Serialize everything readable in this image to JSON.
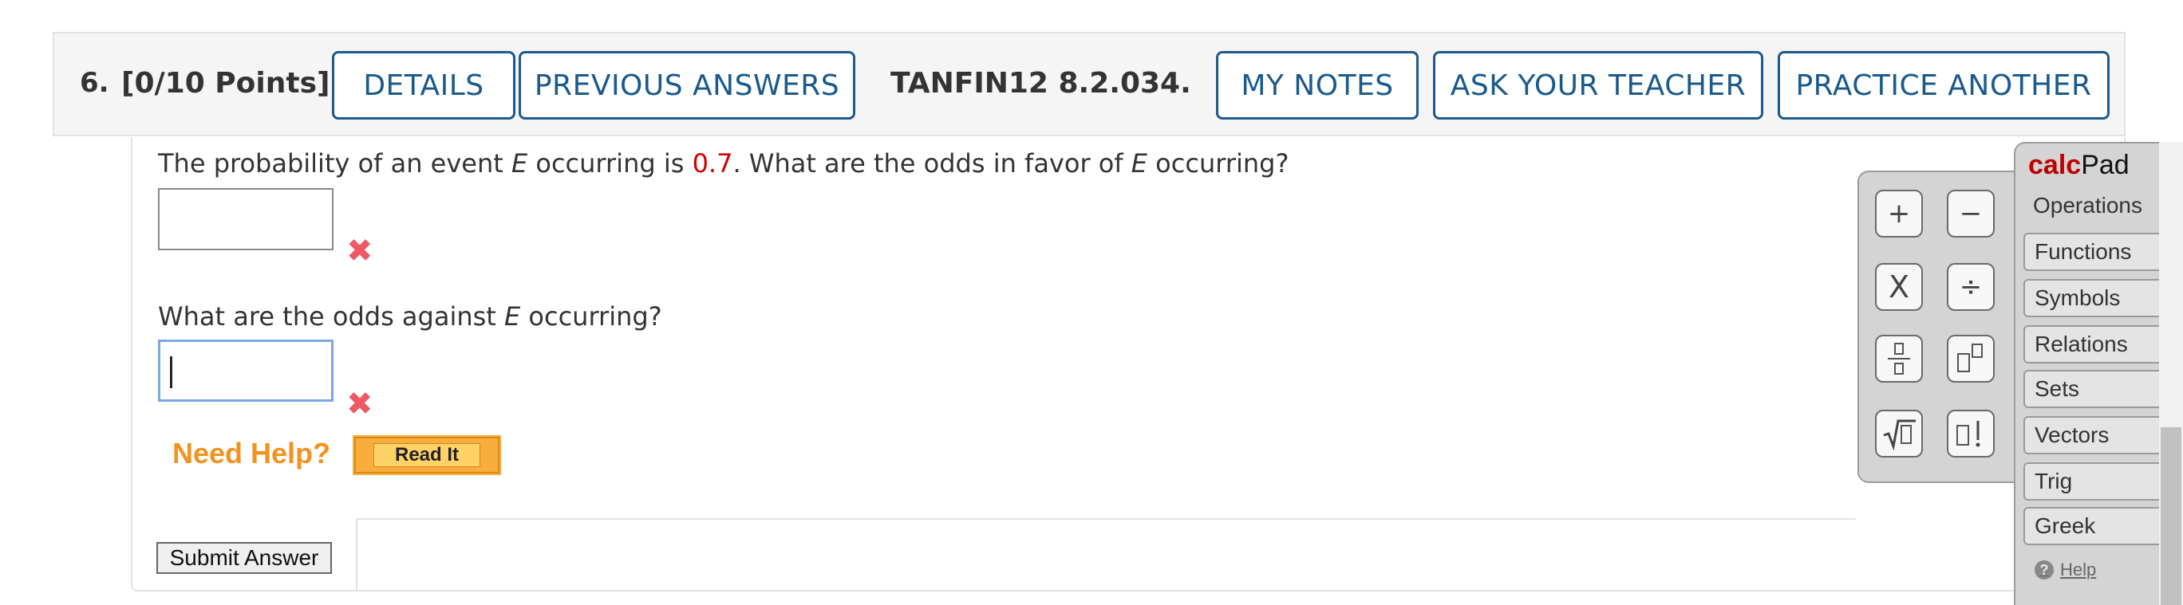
{
  "header": {
    "question_number": "6.",
    "points": "[0/10 Points]",
    "details_label": "DETAILS",
    "previous_answers_label": "PREVIOUS ANSWERS",
    "question_code": "TANFIN12 8.2.034.",
    "my_notes_label": "MY NOTES",
    "ask_teacher_label": "ASK YOUR TEACHER",
    "practice_another_label": "PRACTICE ANOTHER"
  },
  "question": {
    "q1_prefix": "The probability of an event ",
    "q1_var": "E",
    "q1_mid": " occurring is ",
    "q1_value": "0.7",
    "q1_mid2": ". What are the odds in favor of ",
    "q1_var2": "E",
    "q1_suffix": " occurring?",
    "q2_prefix": "What are the odds against ",
    "q2_var": "E",
    "q2_suffix": " occurring?",
    "answer1_value": "",
    "answer2_value": "",
    "answer1_status_icon": "incorrect-x-icon",
    "answer2_status_icon": "incorrect-x-icon",
    "incorrect_mark": "✖",
    "highlight_color": "#d40000"
  },
  "help": {
    "need_help_label": "Need Help?",
    "read_it_label": "Read It"
  },
  "submit": {
    "label": "Submit Answer"
  },
  "calcpad": {
    "title_red": "calc",
    "title_black": "Pad",
    "keys": [
      "+",
      "−",
      "X",
      "÷",
      "▯/▯",
      "▯▯",
      "√▯",
      "▯!"
    ],
    "tabs": [
      "Operations",
      "Functions",
      "Symbols",
      "Relations",
      "Sets",
      "Vectors",
      "Trig",
      "Greek"
    ],
    "active_tab": "Operations",
    "help_label": "Help",
    "help_icon": "?"
  },
  "colors": {
    "accent_blue": "#1a5a8c",
    "need_help_orange": "#f4921f",
    "incorrect_red": "#ee5a64"
  }
}
